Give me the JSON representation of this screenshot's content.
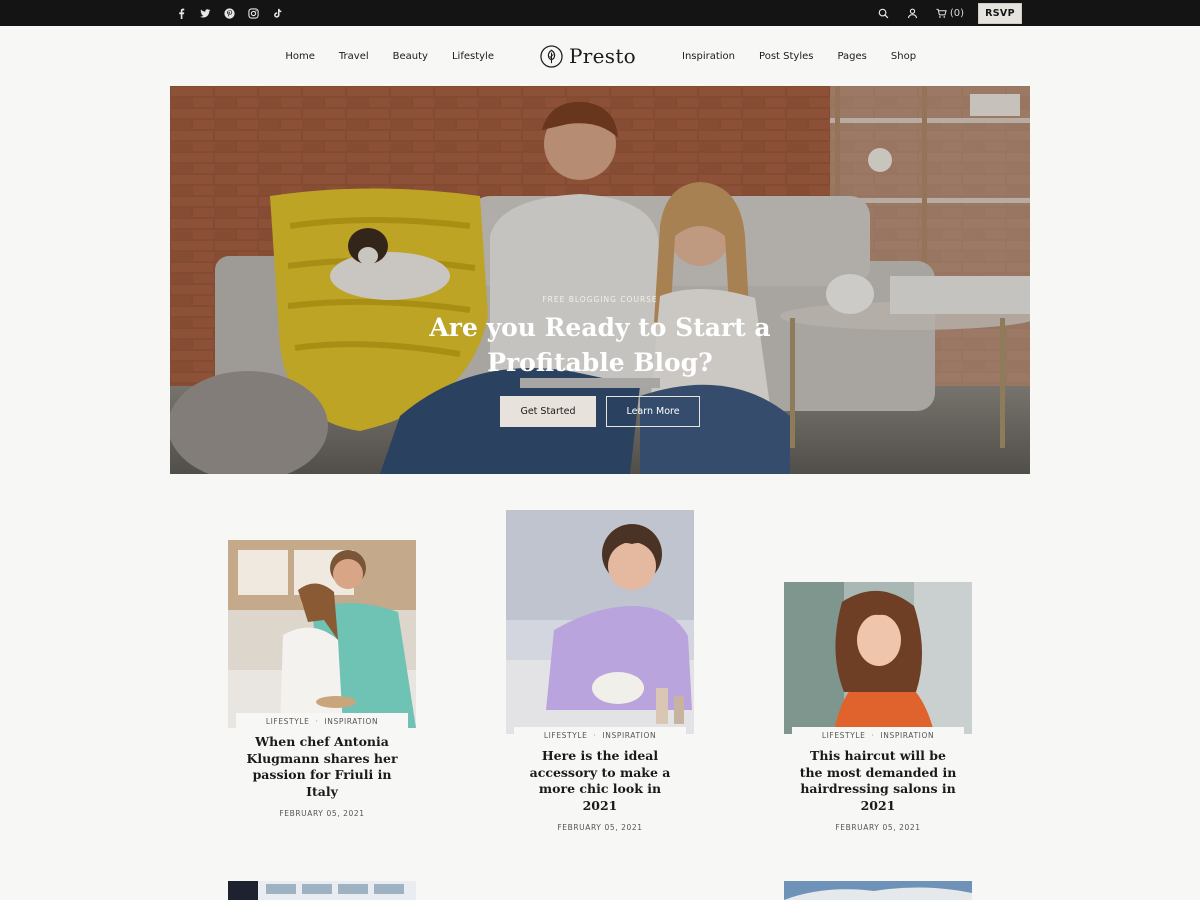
{
  "topbar": {
    "social_icons": [
      "facebook-icon",
      "twitter-icon",
      "pinterest-icon",
      "instagram-icon",
      "tiktok-icon"
    ],
    "cart_count": "(0)",
    "rsvp_label": "RSVP"
  },
  "header": {
    "nav_left": [
      "Home",
      "Travel",
      "Beauty",
      "Lifestyle"
    ],
    "logo_text": "Presto",
    "nav_right": [
      "Inspiration",
      "Post Styles",
      "Pages",
      "Shop"
    ]
  },
  "hero": {
    "eyebrow": "FREE BLOGGING COURSE",
    "title": "Are you Ready to Start a Profitable Blog?",
    "primary_button": "Get Started",
    "secondary_button": "Learn More"
  },
  "posts": [
    {
      "category_1": "LIFESTYLE",
      "category_2": "INSPIRATION",
      "title": "When chef Antonia Klugmann shares her passion for Friuli in Italy",
      "date": "FEBRUARY 05, 2021"
    },
    {
      "category_1": "LIFESTYLE",
      "category_2": "INSPIRATION",
      "title": "Here is the ideal accessory to make a more chic look in 2021",
      "date": "FEBRUARY 05, 2021"
    },
    {
      "category_1": "LIFESTYLE",
      "category_2": "INSPIRATION",
      "title": "This haircut will be the most demanded in hairdressing salons in 2021",
      "date": "FEBRUARY 05, 2021"
    }
  ],
  "colors": {
    "topbar_bg": "#141414",
    "page_bg": "#f7f7f6",
    "rsvp_bg": "#e6e3df",
    "text": "#1a1a1a"
  }
}
